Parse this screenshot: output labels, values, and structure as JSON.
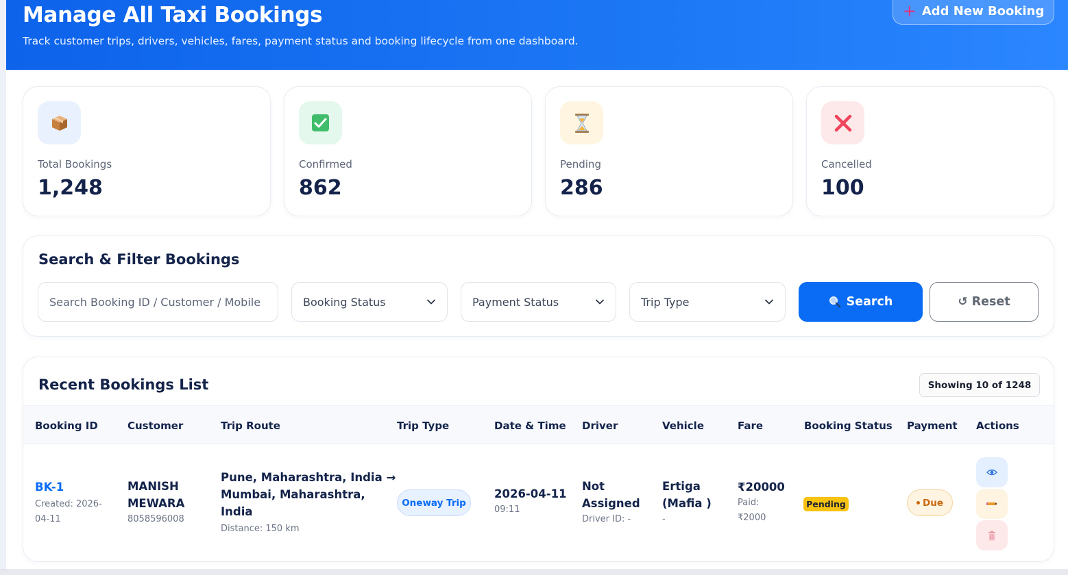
{
  "header": {
    "title": "Manage All Taxi Bookings",
    "subtitle": "Track customer trips, drivers, vehicles, fares, payment status and booking lifecycle from one dashboard.",
    "add_button_label": "Add New Booking"
  },
  "stats": [
    {
      "label": "Total Bookings",
      "value": "1,248",
      "icon": "package-icon",
      "bg": "#eaf1fe"
    },
    {
      "label": "Confirmed",
      "value": "862",
      "icon": "check-box-icon",
      "bg": "#e5f8ee"
    },
    {
      "label": "Pending",
      "value": "286",
      "icon": "hourglass-icon",
      "bg": "#fff5e0"
    },
    {
      "label": "Cancelled",
      "value": "100",
      "icon": "cross-icon",
      "bg": "#fde8ea"
    }
  ],
  "filters": {
    "title": "Search & Filter Bookings",
    "search_placeholder": "Search Booking ID / Customer / Mobile",
    "booking_status": "Booking Status",
    "payment_status": "Payment Status",
    "trip_type": "Trip Type",
    "search_label": "Search",
    "reset_label": "Reset"
  },
  "table": {
    "title": "Recent Bookings List",
    "showing": "Showing 10 of 1248",
    "columns": [
      "Booking ID",
      "Customer",
      "Trip Route",
      "Trip Type",
      "Date & Time",
      "Driver",
      "Vehicle",
      "Fare",
      "Booking Status",
      "Payment",
      "Actions"
    ],
    "rows": [
      {
        "booking_id": "BK-1",
        "created_1": "Created: 2026-",
        "created_2": "04-11",
        "customer_1": "MANISH",
        "customer_2": "MEWARA",
        "mobile": "8058596008",
        "route_1": "Pune, Maharashtra, India →",
        "route_2": "Mumbai, Maharashtra,",
        "route_3": "India",
        "distance": "Distance: 150 km",
        "trip_type": "Oneway Trip",
        "date": "2026-04-11",
        "time": "09:11",
        "driver_1": "Not",
        "driver_2": "Assigned",
        "driver_id": "Driver ID: -",
        "vehicle_1": "Ertiga",
        "vehicle_2": "(Mafia )",
        "vehicle_sub": "-",
        "fare": "₹20000",
        "paid_1": "Paid:",
        "paid_2": "₹2000",
        "booking_status": "Pending",
        "payment": "Due"
      }
    ]
  },
  "colors": {
    "accent": "#0a6cf5",
    "pending": "#f8c211",
    "due": "#c9690e"
  }
}
